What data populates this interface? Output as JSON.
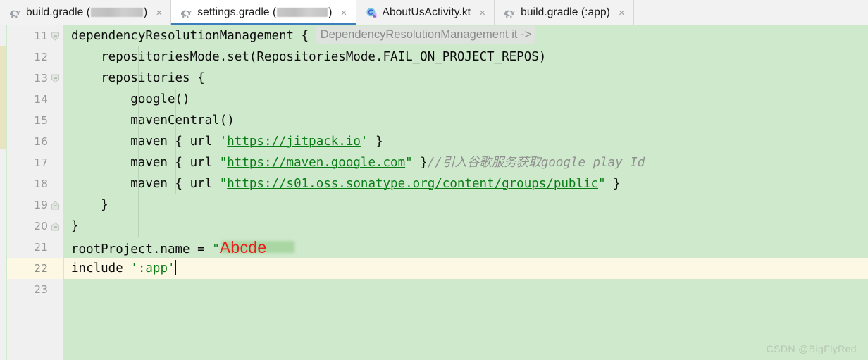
{
  "window": {
    "app": "Android Studio Editor",
    "watermark": "CSDN @BigFlyRed"
  },
  "tabs": [
    {
      "label": "build.gradle (",
      "suffix": ")",
      "icon": "gradle-icon",
      "redacted": true,
      "active": false,
      "close": "×"
    },
    {
      "label": "settings.gradle (",
      "suffix": ")",
      "icon": "gradle-icon",
      "redacted": true,
      "active": true,
      "close": "×"
    },
    {
      "label": "AboutUsActivity.kt",
      "suffix": "",
      "icon": "kotlin-icon",
      "redacted": false,
      "active": false,
      "close": "×"
    },
    {
      "label": "build.gradle (:app)",
      "suffix": "",
      "icon": "gradle-icon",
      "redacted": false,
      "active": false,
      "close": "×"
    }
  ],
  "editor": {
    "first_line": 11,
    "current_line": 22,
    "caret_line": 22,
    "inlay_hint": "DependencyResolutionManagement it ->",
    "annotation": "Abcde",
    "colors": {
      "background": "#cfe9cc",
      "current_line": "#fdf8e3",
      "gutter": "#f0f0f0",
      "string": "#0a7d16",
      "comment": "#8f8f8f",
      "annotation": "#ef1b1b",
      "active_tab_underline": "#3d7ebd"
    },
    "lines": [
      {
        "n": 11,
        "text": "dependencyResolutionManagement {",
        "fold": "collapse-top"
      },
      {
        "n": 12,
        "text": "    repositoriesMode.set(RepositoriesMode.FAIL_ON_PROJECT_REPOS)",
        "fold": ""
      },
      {
        "n": 13,
        "text": "    repositories {",
        "fold": "collapse-top"
      },
      {
        "n": 14,
        "text": "        google()",
        "fold": ""
      },
      {
        "n": 15,
        "text": "        mavenCentral()",
        "fold": ""
      },
      {
        "n": 16,
        "text": "        maven { url 'https://jitpack.io' }",
        "url": "https://jitpack.io",
        "fold": ""
      },
      {
        "n": 17,
        "text": "        maven { url \"https://maven.google.com\" }//引入谷歌服务获取google play Id",
        "url": "https://maven.google.com",
        "comment": "//引入谷歌服务获取google play Id",
        "fold": ""
      },
      {
        "n": 18,
        "text": "        maven { url \"https://s01.oss.sonatype.org/content/groups/public\" }",
        "url": "https://s01.oss.sonatype.org/content/groups/public",
        "fold": ""
      },
      {
        "n": 19,
        "text": "    }",
        "fold": "collapse-bottom"
      },
      {
        "n": 20,
        "text": "}",
        "fold": "collapse-bottom"
      },
      {
        "n": 21,
        "text": "rootProject.name = \"Abcde\"",
        "fold": ""
      },
      {
        "n": 22,
        "text": "include ':app'",
        "string": "':app'",
        "fold": ""
      },
      {
        "n": 23,
        "text": "",
        "fold": ""
      }
    ]
  }
}
